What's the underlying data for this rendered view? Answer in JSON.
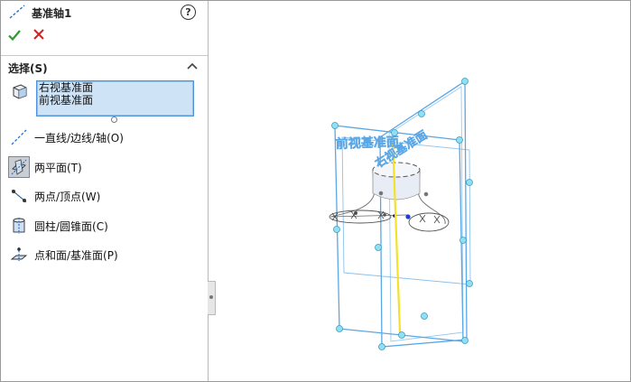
{
  "header": {
    "title": "基准轴1",
    "help_label": "?"
  },
  "section": {
    "title": "选择(S)"
  },
  "selection": {
    "items": [
      "右视基准面",
      "前视基准面"
    ]
  },
  "options": [
    {
      "label": "一直线/边线/轴(O)",
      "icon": "line-edge-axis-icon",
      "pressed": false
    },
    {
      "label": "两平面(T)",
      "icon": "two-planes-icon",
      "pressed": true
    },
    {
      "label": "两点/顶点(W)",
      "icon": "two-points-icon",
      "pressed": false
    },
    {
      "label": "圆柱/圆锥面(C)",
      "icon": "cylinder-cone-icon",
      "pressed": false
    },
    {
      "label": "点和面/基准面(P)",
      "icon": "point-plane-icon",
      "pressed": false
    }
  ],
  "viewport": {
    "front_plane_label": "前视基准面",
    "right_plane_label": "右视基准面"
  },
  "colors": {
    "plane": "#5aa7e6",
    "axis": "#f2e22a",
    "accept": "#2e9b2e",
    "cancel": "#d62020"
  }
}
